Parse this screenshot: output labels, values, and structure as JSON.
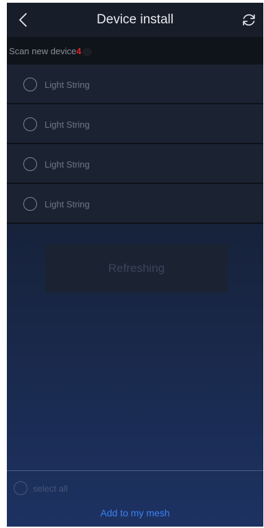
{
  "header": {
    "title": "Device install",
    "back_icon": "chevron-left-icon",
    "refresh_icon": "refresh-icon"
  },
  "scan": {
    "label": "Scan new device",
    "count": "4",
    "count_color": "#e02525"
  },
  "devices": [
    {
      "name": "Light String",
      "selected": false
    },
    {
      "name": "Light String",
      "selected": false
    },
    {
      "name": "Light String",
      "selected": false
    },
    {
      "name": "Light String",
      "selected": false
    }
  ],
  "status": {
    "refreshing_label": "Refreshing"
  },
  "footer": {
    "select_all_label": "select all",
    "add_button_label": "Add to my mesh",
    "accent_color": "#3b82f6"
  }
}
